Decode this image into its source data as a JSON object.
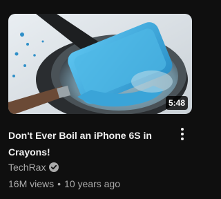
{
  "video": {
    "title": "Don't Ever Boil an iPhone 6S in Crayons!",
    "duration": "5:48",
    "channel": "TechRax",
    "views": "16M views",
    "separator": "•",
    "age": "10 years ago"
  },
  "icons": {
    "menu": "more-vert-icon",
    "verified": "verified-check-icon"
  },
  "colors": {
    "background": "#0f0f0f",
    "title_text": "#f1f1f1",
    "secondary_text": "#aaaaaa",
    "crayon_wax": "#3aa4d8"
  }
}
